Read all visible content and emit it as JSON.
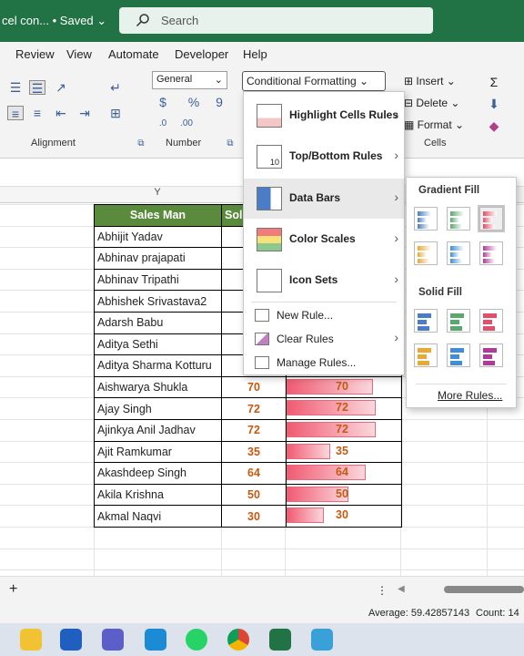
{
  "window": {
    "title": "cel con... • Saved ⌄"
  },
  "search": {
    "placeholder": "Search"
  },
  "menu": [
    "Review",
    "View",
    "Automate",
    "Developer",
    "Help"
  ],
  "ribbon": {
    "number_format": "General",
    "cf_button": "Conditional Formatting ⌄",
    "insert": "Insert",
    "delete": "Delete",
    "format": "Format",
    "groups": {
      "alignment": "Alignment",
      "number": "Number",
      "cells": "Cells"
    }
  },
  "columns": {
    "y": "Y"
  },
  "table": {
    "headers": [
      "Sales Man",
      "Sol"
    ],
    "rows": [
      {
        "name": "Abhijit Yadav",
        "val": ""
      },
      {
        "name": "Abhinav prajapati",
        "val": ""
      },
      {
        "name": "Abhinav Tripathi",
        "val": ""
      },
      {
        "name": "Abhishek Srivastava2",
        "val": ""
      },
      {
        "name": "Adarsh Babu",
        "val": ""
      },
      {
        "name": "Aditya Sethi",
        "val": ""
      },
      {
        "name": "Aditya Sharma Kotturu",
        "val": ""
      },
      {
        "name": "Aishwarya Shukla",
        "val": "70"
      },
      {
        "name": "Ajay Singh",
        "val": "72"
      },
      {
        "name": "Ajinkya Anil Jadhav",
        "val": "72"
      },
      {
        "name": "Ajit Ramkumar",
        "val": "35"
      },
      {
        "name": "Akashdeep Singh",
        "val": "64"
      },
      {
        "name": "Akila Krishna",
        "val": "50"
      },
      {
        "name": "Akmal Naqvi",
        "val": "30"
      }
    ],
    "bars": [
      {
        "label": "70",
        "fill": 0.97
      },
      {
        "label": "72",
        "fill": 1.0
      },
      {
        "label": "72",
        "fill": 1.0
      },
      {
        "label": "35",
        "fill": 0.49
      },
      {
        "label": "64",
        "fill": 0.89
      },
      {
        "label": "50",
        "fill": 0.69
      },
      {
        "label": "30",
        "fill": 0.42
      }
    ]
  },
  "cf_menu": {
    "items": [
      "Highlight Cells Rules",
      "Top/Bottom Rules",
      "Data Bars",
      "Color Scales",
      "Icon Sets"
    ],
    "small_items": [
      "New Rule...",
      "Clear Rules",
      "Manage Rules..."
    ]
  },
  "databars_menu": {
    "gradient_title": "Gradient Fill",
    "solid_title": "Solid Fill",
    "more": "More Rules...",
    "colors": [
      "#4a7cc7",
      "#5aa86b",
      "#e0506a",
      "#e8a935",
      "#3f8fd6",
      "#b03a9a"
    ]
  },
  "status": {
    "average": "Average: 59.42857143",
    "count": "Count: 14"
  }
}
